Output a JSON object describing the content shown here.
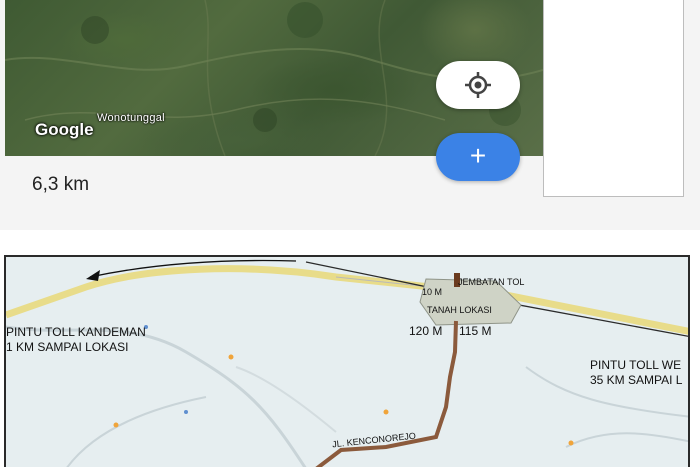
{
  "top_panel": {
    "map_place_label": "Wonotunggal",
    "map_attribution": "Google",
    "distance": "6,3 km",
    "zoom_in_symbol": "+",
    "locate_icon": "my-location-icon"
  },
  "location_map": {
    "toll_bridge": "JEMBATAN TOL",
    "bridge_distance": "10 M",
    "land_label": "TANAH LOKASI",
    "side_west": "120 M",
    "side_east": "115 M",
    "kandeman_gate": "PINTU TOLL KANDEMAN",
    "kandeman_distance": "1 KM SAMPAI LOKASI",
    "east_gate": "PINTU TOLL WE",
    "east_distance": "35 KM SAMPAI L",
    "road_name": "JL. KENCONOREJO",
    "colors": {
      "route": "#8b5a3c",
      "land": "#cfd3c6",
      "toll_road": "#e8dc8a"
    }
  }
}
